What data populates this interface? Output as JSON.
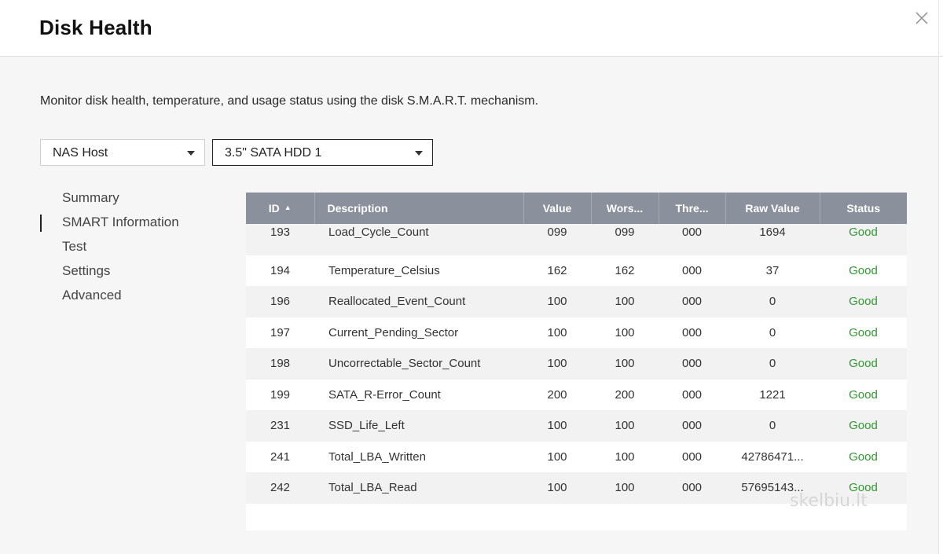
{
  "dialog": {
    "title": "Disk Health",
    "description": "Monitor disk health, temperature, and usage status using the disk S.M.A.R.T. mechanism."
  },
  "filters": {
    "host": "NAS Host",
    "disk": "3.5\" SATA HDD 1"
  },
  "nav": {
    "items": [
      {
        "label": "Summary",
        "active": false
      },
      {
        "label": "SMART Information",
        "active": true
      },
      {
        "label": "Test",
        "active": false
      },
      {
        "label": "Settings",
        "active": false
      },
      {
        "label": "Advanced",
        "active": false
      }
    ]
  },
  "table": {
    "columns": [
      "ID",
      "Description",
      "Value",
      "Wors...",
      "Thre...",
      "Raw Value",
      "Status"
    ],
    "rows": [
      [
        "193",
        "Load_Cycle_Count",
        "099",
        "099",
        "000",
        "1694",
        "Good"
      ],
      [
        "194",
        "Temperature_Celsius",
        "162",
        "162",
        "000",
        "37",
        "Good"
      ],
      [
        "196",
        "Reallocated_Event_Count",
        "100",
        "100",
        "000",
        "0",
        "Good"
      ],
      [
        "197",
        "Current_Pending_Sector",
        "100",
        "100",
        "000",
        "0",
        "Good"
      ],
      [
        "198",
        "Uncorrectable_Sector_Count",
        "100",
        "100",
        "000",
        "0",
        "Good"
      ],
      [
        "199",
        "SATA_R-Error_Count",
        "200",
        "200",
        "000",
        "1221",
        "Good"
      ],
      [
        "231",
        "SSD_Life_Left",
        "100",
        "100",
        "000",
        "0",
        "Good"
      ],
      [
        "241",
        "Total_LBA_Written",
        "100",
        "100",
        "000",
        "42786471...",
        "Good"
      ],
      [
        "242",
        "Total_LBA_Read",
        "100",
        "100",
        "000",
        "57695143...",
        "Good"
      ]
    ]
  },
  "watermark": "skelbiu.lt",
  "colors": {
    "header_bg": "#8a909c",
    "status_good": "#2e9b2e"
  }
}
